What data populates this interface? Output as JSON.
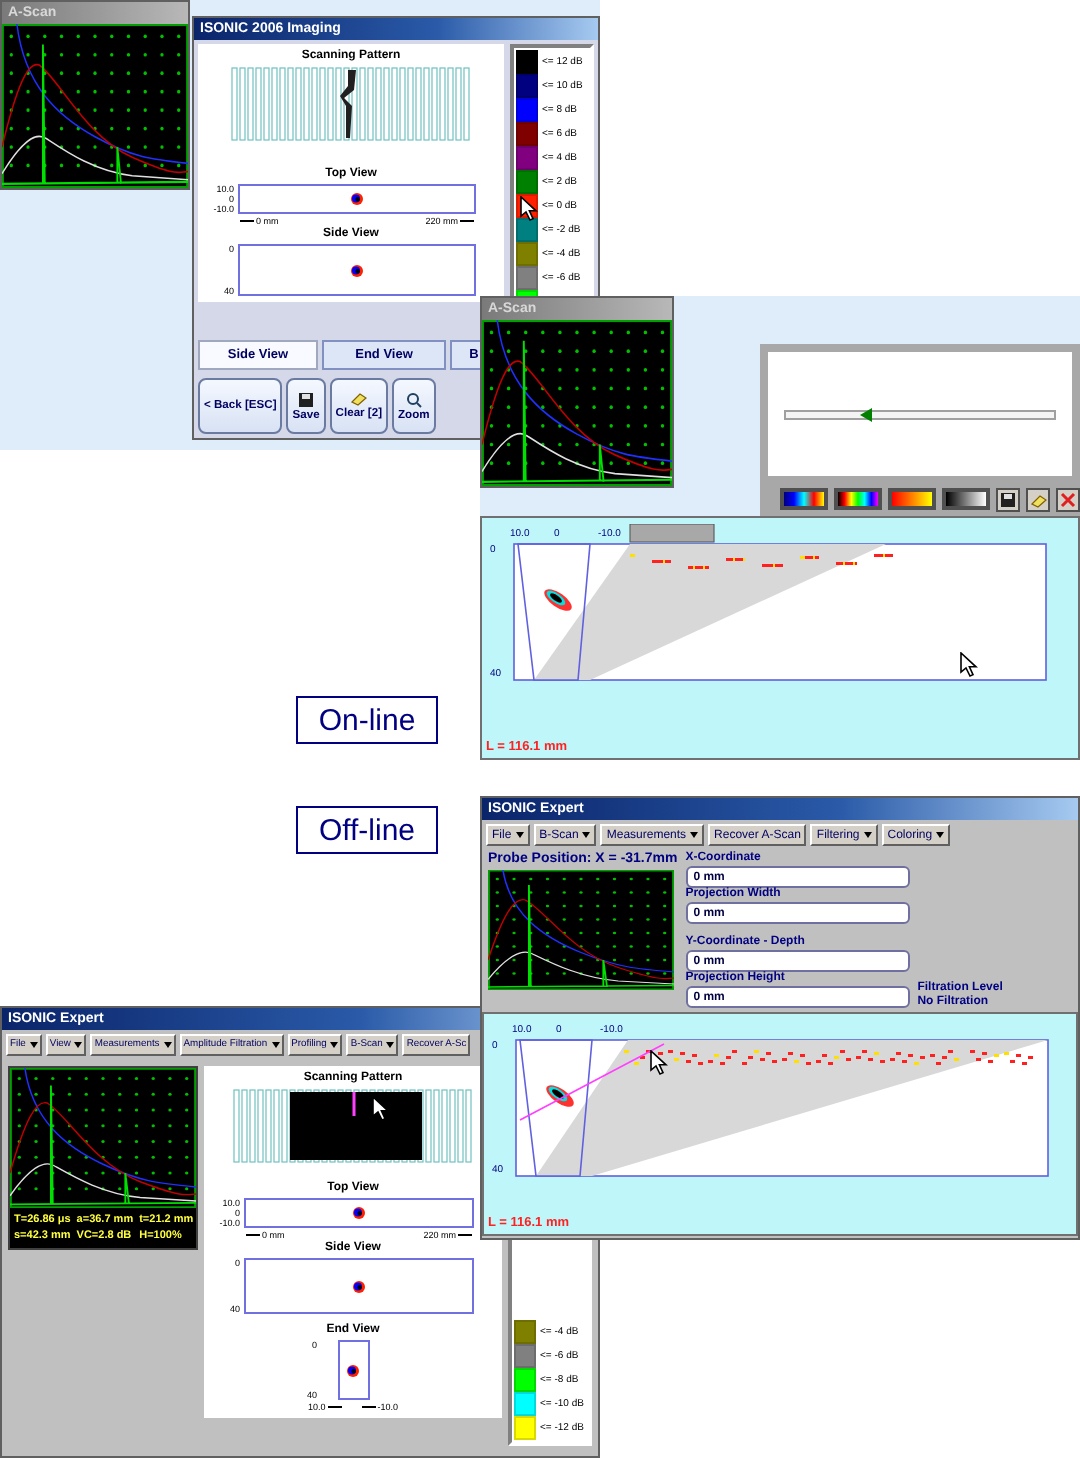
{
  "ascan_window": {
    "title": "A-Scan"
  },
  "imaging_window": {
    "title": "ISONIC 2006 Imaging",
    "scanning_pattern": "Scanning Pattern",
    "top_view": {
      "title": "Top View",
      "y_ticks": [
        "10.0",
        "0",
        "-10.0"
      ],
      "x_start": "0 mm",
      "x_end": "220 mm"
    },
    "side_view": {
      "title": "Side View",
      "y_ticks": [
        "0",
        "40"
      ]
    },
    "legend": [
      {
        "label": "<= 12 dB",
        "color": "#000000"
      },
      {
        "label": "<= 10 dB",
        "color": "#000080"
      },
      {
        "label": "<= 8 dB",
        "color": "#0000ff"
      },
      {
        "label": "<= 6 dB",
        "color": "#800000"
      },
      {
        "label": "<= 4 dB",
        "color": "#800080"
      },
      {
        "label": "<= 2 dB",
        "color": "#008000"
      },
      {
        "label": "<= 0 dB",
        "color": "#ff2000"
      },
      {
        "label": "<= -2 dB",
        "color": "#008080"
      },
      {
        "label": "<= -4 dB",
        "color": "#808000"
      },
      {
        "label": "<= -6 dB",
        "color": "#808080"
      },
      {
        "color": "#00ff00"
      }
    ],
    "tabs": [
      {
        "label": "Side View",
        "selected": true
      },
      {
        "label": "End View",
        "selected": false
      },
      {
        "label": "B",
        "selected": false
      }
    ],
    "buttons": [
      {
        "kind": "back",
        "label": "< Back [ESC]"
      },
      {
        "kind": "save",
        "label": "Save"
      },
      {
        "kind": "clear",
        "label": "Clear [2]"
      },
      {
        "kind": "zoom",
        "label": "Zoom"
      }
    ]
  },
  "online": {
    "ascan_title": "A-Scan",
    "slider": {
      "level": 0.3
    },
    "bscan": {
      "x_ticks": [
        "10.0",
        "0",
        "-10.0"
      ],
      "y_ticks": [
        "0",
        "40"
      ],
      "length": "L = 116.1 mm"
    }
  },
  "mode_labels": [
    "On-line",
    "Off-line"
  ],
  "offline_window": {
    "title": "ISONIC Expert",
    "menu": [
      {
        "label": "File",
        "dropdown": true
      },
      {
        "label": "B-Scan",
        "dropdown": true
      },
      {
        "label": "Measurements",
        "dropdown": true
      },
      {
        "label": "Recover A-Scan",
        "dropdown": false
      },
      {
        "label": "Filtering",
        "dropdown": true
      },
      {
        "label": "Coloring",
        "dropdown": true
      }
    ],
    "probe_position": "Probe Position: X = -31.7mm",
    "fields": [
      {
        "label": "X-Coordinate",
        "value": "0 mm"
      },
      {
        "label": "Projection Width",
        "value": "0 mm"
      },
      {
        "label": "Y-Coordinate - Depth",
        "value": "0 mm"
      },
      {
        "label": "Projection Height",
        "value": "0 mm"
      }
    ],
    "filtration_label": "Filtration Level",
    "filtration_value": "No Filtration",
    "bscan": {
      "x_ticks": [
        "10.0",
        "0",
        "-10.0"
      ],
      "y_ticks": [
        "0",
        "40"
      ],
      "length": "L = 116.1 mm"
    }
  },
  "expert_window": {
    "title": "ISONIC Expert",
    "menu": [
      {
        "label": "File",
        "dropdown": true
      },
      {
        "label": "View",
        "dropdown": true
      },
      {
        "label": "Measurements",
        "dropdown": true
      },
      {
        "label": "Amplitude Filtration",
        "dropdown": true
      },
      {
        "label": "Profiling",
        "dropdown": true
      },
      {
        "label": "B-Scan",
        "dropdown": true
      },
      {
        "label": "Recover A-Sc",
        "dropdown": false
      }
    ],
    "readouts": [
      "T=26.86 μs",
      "a=36.7 mm",
      "t=21.2 mm",
      "s=42.3 mm",
      "VC=2.8 dB",
      "H=100%"
    ],
    "scanning_pattern": "Scanning Pattern",
    "top_view": {
      "title": "Top View",
      "y_ticks": [
        "10.0",
        "0",
        "-10.0"
      ],
      "x_start": "0 mm",
      "x_end": "220 mm"
    },
    "side_view": {
      "title": "Side View",
      "y_ticks": [
        "0",
        "40"
      ]
    },
    "end_view": {
      "title": "End View",
      "y_ticks": [
        "0",
        "40"
      ],
      "x_start": "10.0",
      "x_end": "-10.0"
    },
    "legend": [
      {
        "label": "<= -4 dB",
        "color": "#808000"
      },
      {
        "label": "<= -6 dB",
        "color": "#808080"
      },
      {
        "label": "<= -8 dB",
        "color": "#00ff00"
      },
      {
        "label": "<= -10 dB",
        "color": "#00ffff"
      },
      {
        "label": "<= -12 dB",
        "color": "#ffff00"
      }
    ]
  }
}
